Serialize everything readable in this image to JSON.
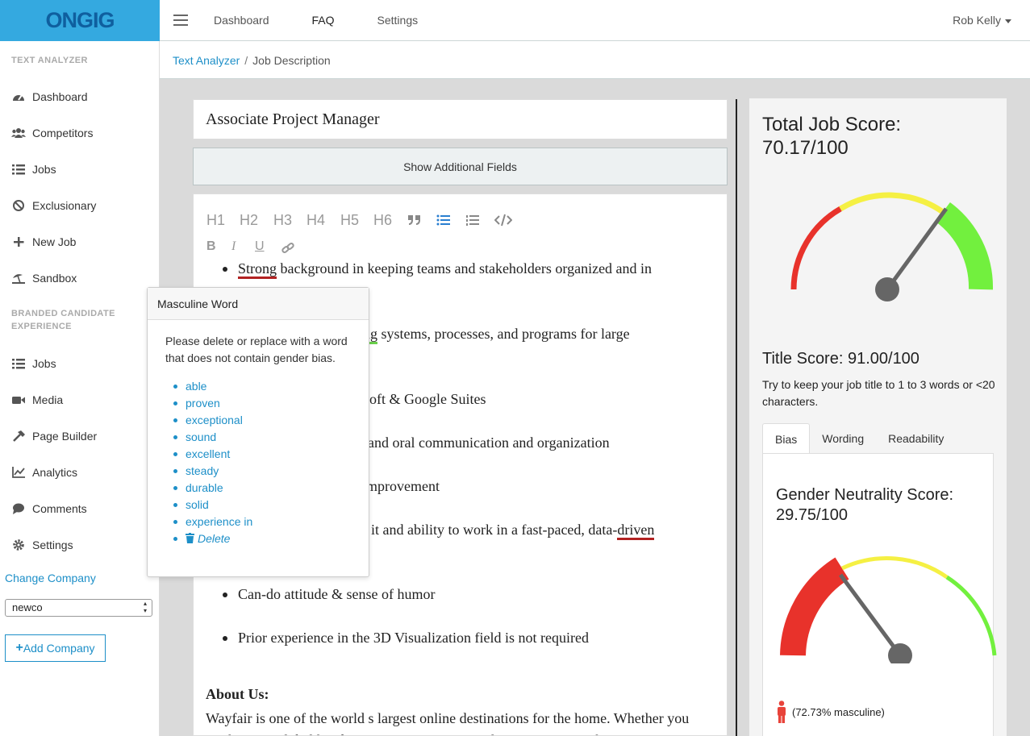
{
  "brand": {
    "logo": "ONGIG"
  },
  "topnav": {
    "items": [
      "Dashboard",
      "FAQ",
      "Settings"
    ],
    "user": "Rob Kelly"
  },
  "sidebar": {
    "section1": "TEXT ANALYZER",
    "items1": [
      "Dashboard",
      "Competitors",
      "Jobs",
      "Exclusionary",
      "New Job",
      "Sandbox"
    ],
    "section2": "BRANDED CANDIDATE EXPERIENCE",
    "items2": [
      "Jobs",
      "Media",
      "Page Builder",
      "Analytics",
      "Comments",
      "Settings"
    ],
    "change_company": "Change Company",
    "company_select": "newco",
    "add_company": "Add Company"
  },
  "breadcrumb": {
    "root": "Text Analyzer",
    "sep": "/",
    "current": "Job Description"
  },
  "job": {
    "title": "Associate Project Manager",
    "show_fields": "Show Additional Fields"
  },
  "toolbar": {
    "headings": [
      "H1",
      "H2",
      "H3",
      "H4",
      "H5",
      "H6"
    ],
    "bold": "B",
    "italic": "I",
    "underline": "U"
  },
  "editor": {
    "b1_word": "Strong",
    "b1_rest": " background in keeping teams and stakeholders organized and in",
    "b2_tail_word": "ng",
    "b2_tail_rest": " systems, processes, and programs for large",
    "b3_tail": "oft & Google Suites",
    "b4_tail": "and oral communication and organization",
    "b5_tail": "mprovement",
    "b6_tail_pre": "it and ability to work in a fast-paced, data-",
    "b6_tail_word": "driven",
    "b7": "Can-do attitude & sense of humor",
    "b8": "Prior experience in the 3D Visualization field is not required",
    "about_heading": "About Us:",
    "about_text": "Wayfair is one of the world s largest online destinations for the home. Whether you work in our global headquarters in Boston or Berlin, or in our warehouses"
  },
  "popover": {
    "title": "Masculine Word",
    "instruction": "Please delete or replace with a word that does not contain gender bias.",
    "suggestions": [
      "able",
      "proven",
      "exceptional",
      "sound",
      "excellent",
      "steady",
      "durable",
      "solid",
      "experience in"
    ],
    "delete": "Delete"
  },
  "scores": {
    "total_label": "Total Job Score:",
    "total_value": "70.17/100",
    "total_level": 0.7017,
    "title_score": "Title Score: 91.00/100",
    "title_note": "Try to keep your job title to 1 to 3 words or <20 characters.",
    "tabs": [
      "Bias",
      "Wording",
      "Readability"
    ],
    "gender_label": "Gender Neutrality Score:",
    "gender_value": "29.75/100",
    "gender_level": 0.2975,
    "masculine": "(72.73% masculine)"
  },
  "colors": {
    "accent": "#1d8fc8",
    "logo_bg": "#34a9e0",
    "gauge_red": "#e8322b",
    "gauge_yellow": "#f5f043",
    "gauge_green": "#72f03e"
  }
}
